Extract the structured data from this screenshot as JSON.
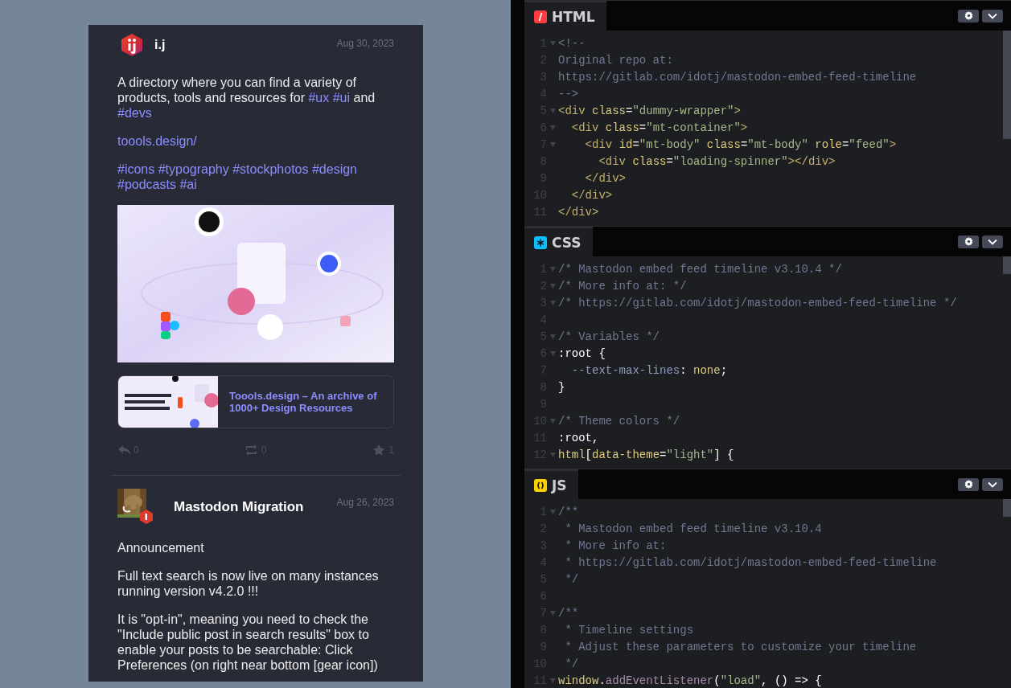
{
  "feed": {
    "posts": [
      {
        "author": "i.j",
        "date": "Aug 30, 2023",
        "avatar": {
          "kind": "logo"
        },
        "paragraphs": [
          {
            "segments": [
              {
                "kind": "text",
                "text": "A directory where you can find a variety of products, tools and resources for "
              },
              {
                "kind": "tag",
                "text": "#ux"
              },
              {
                "kind": "tag",
                "text": "#ui"
              },
              {
                "kind": "text",
                "text": "  and "
              },
              {
                "kind": "tag",
                "text": "#devs"
              }
            ]
          },
          {
            "segments": [
              {
                "kind": "link",
                "text": "toools.design/"
              }
            ]
          },
          {
            "segments": [
              {
                "kind": "tag",
                "text": "#icons"
              },
              {
                "kind": "tag",
                "text": "#typography"
              },
              {
                "kind": "tag",
                "text": "#stockphotos"
              },
              {
                "kind": "tag",
                "text": "#design"
              },
              {
                "kind": "tag",
                "text": "#podcasts"
              },
              {
                "kind": "tag",
                "text": "#ai"
              }
            ]
          }
        ],
        "media": {
          "kind": "picture"
        },
        "preview": {
          "title": "Toools.design – An archive of 1000+ Design Resources"
        },
        "actions": [
          {
            "kind": "reply",
            "count": "0"
          },
          {
            "kind": "boost",
            "count": "0"
          },
          {
            "kind": "favourite",
            "count": "1"
          }
        ]
      },
      {
        "author": "Mastodon Migration",
        "date": "Aug 26, 2023",
        "avatar": {
          "kind": "picture"
        },
        "paragraphs": [
          {
            "segments": [
              {
                "kind": "text",
                "text": "Announcement"
              }
            ]
          },
          {
            "segments": [
              {
                "kind": "text",
                "text": "Full text search is now live on many instances running version v4.2.0 !!!"
              }
            ]
          },
          {
            "segments": [
              {
                "kind": "text",
                "text": "It is \"opt-in\", meaning you need to check the \"Include public post in search results\" box to enable your posts to be searchable: Click Preferences (on right near bottom [gear icon])"
              }
            ]
          }
        ]
      }
    ]
  },
  "editor": {
    "panels": [
      {
        "kind": "html",
        "label": "HTML",
        "lines": [
          {
            "n": "1",
            "fold": true,
            "tokens": [
              {
                "kind": "comment",
                "text": "<!--"
              }
            ]
          },
          {
            "n": "2",
            "fold": false,
            "tokens": [
              {
                "kind": "comment",
                "text": "Original repo at:"
              }
            ]
          },
          {
            "n": "3",
            "fold": false,
            "tokens": [
              {
                "kind": "comment",
                "text": "https://gitlab.com/idotj/mastodon-embed-feed-timeline"
              }
            ]
          },
          {
            "n": "4",
            "fold": false,
            "tokens": [
              {
                "kind": "comment",
                "text": "-->"
              }
            ]
          },
          {
            "n": "5",
            "fold": true,
            "tokens": [
              {
                "kind": "tag",
                "text": "<div "
              },
              {
                "kind": "attr",
                "text": "class"
              },
              {
                "kind": "plain",
                "text": "="
              },
              {
                "kind": "string",
                "text": "\"dummy-wrapper\""
              },
              {
                "kind": "tag",
                "text": ">"
              }
            ]
          },
          {
            "n": "6",
            "fold": true,
            "tokens": [
              {
                "kind": "tag",
                "text": "  <div "
              },
              {
                "kind": "attr",
                "text": "class"
              },
              {
                "kind": "plain",
                "text": "="
              },
              {
                "kind": "string",
                "text": "\"mt-container\""
              },
              {
                "kind": "tag",
                "text": ">"
              }
            ]
          },
          {
            "n": "7",
            "fold": true,
            "tokens": [
              {
                "kind": "tag",
                "text": "    <div "
              },
              {
                "kind": "attr",
                "text": "id"
              },
              {
                "kind": "plain",
                "text": "="
              },
              {
                "kind": "string",
                "text": "\"mt-body\" "
              },
              {
                "kind": "attr",
                "text": "class"
              },
              {
                "kind": "plain",
                "text": "="
              },
              {
                "kind": "string",
                "text": "\"mt-body\" "
              },
              {
                "kind": "attr",
                "text": "role"
              },
              {
                "kind": "plain",
                "text": "="
              },
              {
                "kind": "string",
                "text": "\"feed\""
              },
              {
                "kind": "tag",
                "text": ">"
              }
            ]
          },
          {
            "n": "8",
            "fold": false,
            "tokens": [
              {
                "kind": "tag",
                "text": "      <div "
              },
              {
                "kind": "attr",
                "text": "class"
              },
              {
                "kind": "plain",
                "text": "="
              },
              {
                "kind": "string",
                "text": "\"loading-spinner\""
              },
              {
                "kind": "tag",
                "text": "></div>"
              }
            ]
          },
          {
            "n": "9",
            "fold": false,
            "tokens": [
              {
                "kind": "tag",
                "text": "    </div>"
              }
            ]
          },
          {
            "n": "10",
            "fold": false,
            "tokens": [
              {
                "kind": "tag",
                "text": "  </div>"
              }
            ]
          },
          {
            "n": "11",
            "fold": false,
            "tokens": [
              {
                "kind": "tag",
                "text": "</div>"
              }
            ]
          }
        ]
      },
      {
        "kind": "css",
        "label": "CSS",
        "lines": [
          {
            "n": "1",
            "fold": true,
            "tokens": [
              {
                "kind": "comment",
                "text": "/* Mastodon embed feed timeline v3.10.4 */"
              }
            ]
          },
          {
            "n": "2",
            "fold": true,
            "tokens": [
              {
                "kind": "comment",
                "text": "/* More info at: */"
              }
            ]
          },
          {
            "n": "3",
            "fold": true,
            "tokens": [
              {
                "kind": "comment",
                "text": "/* https://gitlab.com/idotj/mastodon-embed-feed-timeline */"
              }
            ]
          },
          {
            "n": "4",
            "fold": false
          },
          {
            "n": "5",
            "fold": true,
            "tokens": [
              {
                "kind": "comment",
                "text": "/* Variables */"
              }
            ]
          },
          {
            "n": "6",
            "fold": true,
            "tokens": [
              {
                "kind": "plain",
                "text": ":root {"
              }
            ]
          },
          {
            "n": "7",
            "fold": false,
            "tokens": [
              {
                "kind": "prop",
                "text": "  --text-max-lines"
              },
              {
                "kind": "plain",
                "text": ": "
              },
              {
                "kind": "value",
                "text": "none"
              },
              {
                "kind": "plain",
                "text": ";"
              }
            ]
          },
          {
            "n": "8",
            "fold": false,
            "tokens": [
              {
                "kind": "plain",
                "text": "}"
              }
            ]
          },
          {
            "n": "9",
            "fold": false
          },
          {
            "n": "10",
            "fold": true,
            "tokens": [
              {
                "kind": "comment",
                "text": "/* Theme colors */"
              }
            ]
          },
          {
            "n": "11",
            "fold": false,
            "tokens": [
              {
                "kind": "plain",
                "text": ":root,"
              }
            ]
          },
          {
            "n": "12",
            "fold": true,
            "tokens": [
              {
                "kind": "value",
                "text": "html"
              },
              {
                "kind": "plain",
                "text": "["
              },
              {
                "kind": "value",
                "text": "data-theme"
              },
              {
                "kind": "plain",
                "text": "="
              },
              {
                "kind": "string",
                "text": "\"light\""
              },
              {
                "kind": "plain",
                "text": "] {"
              }
            ]
          }
        ]
      },
      {
        "kind": "js",
        "label": "JS",
        "lines": [
          {
            "n": "1",
            "fold": true,
            "tokens": [
              {
                "kind": "comment",
                "text": "/**"
              }
            ]
          },
          {
            "n": "2",
            "fold": false,
            "tokens": [
              {
                "kind": "comment",
                "text": " * Mastodon embed feed timeline v3.10.4"
              }
            ]
          },
          {
            "n": "3",
            "fold": false,
            "tokens": [
              {
                "kind": "comment",
                "text": " * More info at:"
              }
            ]
          },
          {
            "n": "4",
            "fold": false,
            "tokens": [
              {
                "kind": "comment",
                "text": " * https://gitlab.com/idotj/mastodon-embed-feed-timeline"
              }
            ]
          },
          {
            "n": "5",
            "fold": false,
            "tokens": [
              {
                "kind": "comment",
                "text": " */"
              }
            ]
          },
          {
            "n": "6",
            "fold": false
          },
          {
            "n": "7",
            "fold": true,
            "tokens": [
              {
                "kind": "comment",
                "text": "/**"
              }
            ]
          },
          {
            "n": "8",
            "fold": false,
            "tokens": [
              {
                "kind": "comment",
                "text": " * Timeline settings"
              }
            ]
          },
          {
            "n": "9",
            "fold": false,
            "tokens": [
              {
                "kind": "comment",
                "text": " * Adjust these parameters to customize your timeline"
              }
            ]
          },
          {
            "n": "10",
            "fold": false,
            "tokens": [
              {
                "kind": "comment",
                "text": " */"
              }
            ]
          },
          {
            "n": "11",
            "fold": true,
            "tokens": [
              {
                "kind": "value",
                "text": "window"
              },
              {
                "kind": "plain",
                "text": "."
              },
              {
                "kind": "func",
                "text": "addEventListener"
              },
              {
                "kind": "plain",
                "text": "("
              },
              {
                "kind": "string",
                "text": "\"load\""
              },
              {
                "kind": "plain",
                "text": ", () => {"
              }
            ]
          }
        ]
      }
    ]
  }
}
